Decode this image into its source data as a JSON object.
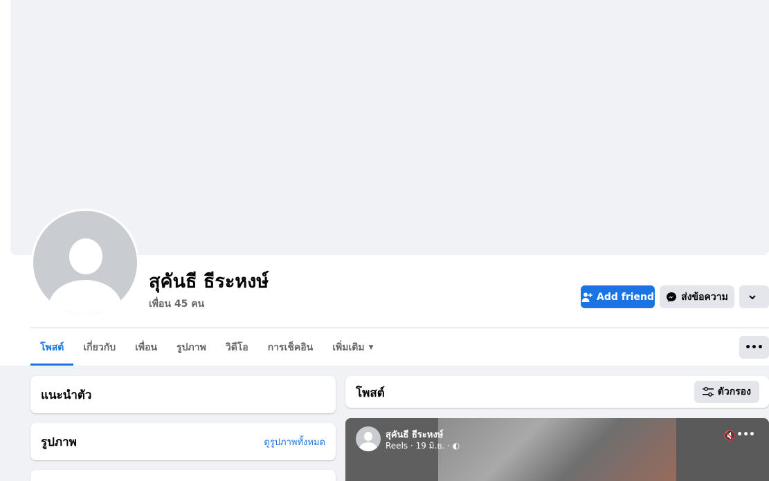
{
  "profile": {
    "name": "สุคันธี ธีระหงษ์",
    "friends_count": "เพื่อน 45 คน"
  },
  "actions": {
    "add_friend": "Add friend",
    "message": "ส่งข้อความ"
  },
  "tabs": [
    {
      "label": "โพสต์"
    },
    {
      "label": "เกี่ยวกับ"
    },
    {
      "label": "เพื่อน"
    },
    {
      "label": "รูปภาพ"
    },
    {
      "label": "วิดีโอ"
    },
    {
      "label": "การเช็คอิน"
    },
    {
      "label": "เพิ่มเติม"
    }
  ],
  "intro": {
    "title": "แนะนำตัว"
  },
  "photos": {
    "title": "รูปภาพ",
    "see_all": "ดูรูปภาพทั้งหมด"
  },
  "posts": {
    "title": "โพสต์",
    "filter": "ตัวกรอง"
  },
  "reel": {
    "author": "สุคันธี ธีระหงษ์",
    "meta": "Reels · 19 มิ.ย. ·"
  },
  "colors": {
    "accent": "#1b74e4",
    "background": "#f0f2f5",
    "button_gray": "#e4e6eb"
  }
}
